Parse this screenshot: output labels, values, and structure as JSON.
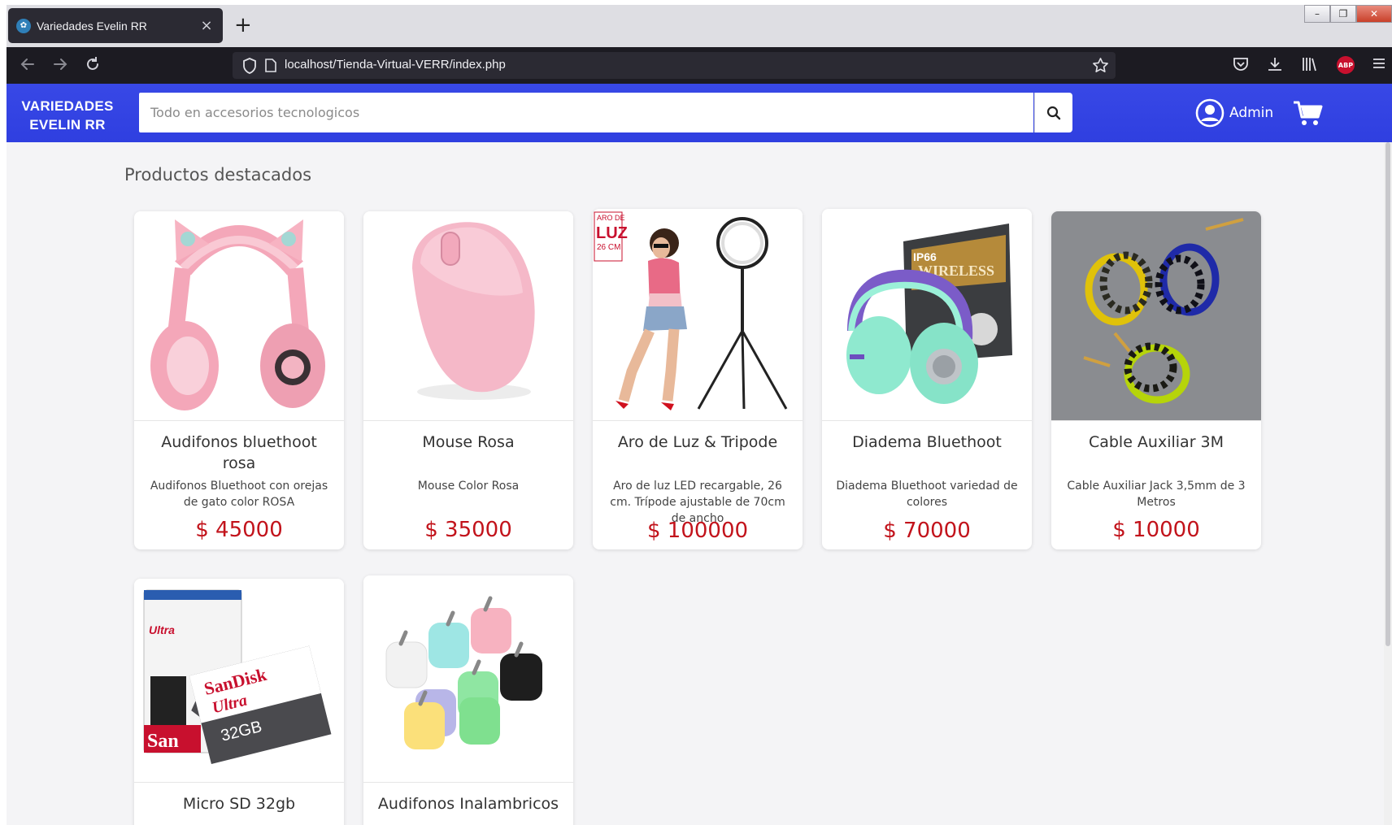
{
  "browser": {
    "tab_title": "Variedades Evelin RR",
    "tab_close": "×",
    "new_tab": "+",
    "url": "localhost/Tienda-Virtual-VERR/index.php",
    "abp_label": "ABP"
  },
  "site": {
    "brand_line1": "VARIEDADES",
    "brand_line2": "EVELIN RR",
    "search_placeholder": "Todo en accesorios tecnologicos",
    "admin_label": "Admin",
    "accent_color": "#3848e6",
    "price_color": "#c2131b"
  },
  "main": {
    "title": "Productos destacados",
    "products": [
      {
        "name": "Audifonos bluethoot rosa",
        "description": "Audifonos Bluethoot con orejas de gato color ROSA",
        "price": "$ 45000",
        "image": "pink-cat-ear-headphones"
      },
      {
        "name": "Mouse Rosa",
        "description": "Mouse Color Rosa",
        "price": "$ 35000",
        "image": "pink-mouse"
      },
      {
        "name": "Aro de Luz & Tripode",
        "description": "Aro de luz LED recargable, 26 cm. Trípode ajustable de 70cm de ancho",
        "price": "$ 100000",
        "image": "ring-light-tripod",
        "image_text": [
          "ARO DE",
          "LUZ",
          "26 CM"
        ]
      },
      {
        "name": "Diadema Bluethoot",
        "description": "Diadema Bluethoot variedad de colores",
        "price": "$ 70000",
        "image": "mint-headphones-box",
        "image_text": [
          "IP66",
          "WIRELESS"
        ]
      },
      {
        "name": "Cable Auxiliar 3M",
        "description": "Cable Auxiliar Jack 3,5mm de 3 Metros",
        "price": "$ 10000",
        "image": "aux-cables"
      },
      {
        "name": "Micro SD 32gb",
        "description": "",
        "price": "",
        "image": "sandisk-microsd",
        "image_text": [
          "SanDisk",
          "Ultra",
          "32GB",
          "San"
        ]
      },
      {
        "name": "Audifonos Inalambricos",
        "description": "",
        "price": "",
        "image": "wireless-earbuds"
      }
    ]
  }
}
